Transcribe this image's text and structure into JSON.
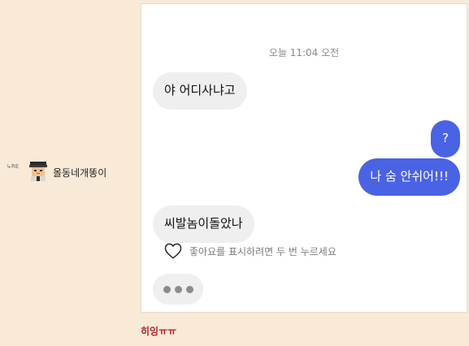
{
  "post": {
    "reply_tag": "↳RE",
    "author": "올동네개똥이",
    "caption": "히잉ㅠㅠ"
  },
  "chat": {
    "timestamp": "오늘 11:04 오전",
    "messages": [
      {
        "side": "incoming",
        "text": "야 어디사냐고"
      },
      {
        "side": "outgoing",
        "text": "?"
      },
      {
        "side": "outgoing",
        "text": "나 숨 안쉬어!!!"
      },
      {
        "side": "incoming",
        "text": "씨발놈이돌았나"
      }
    ],
    "like_hint": "좋아요를 표시하려면 두 번 누르세요",
    "typing_indicator": true
  },
  "colors": {
    "page_background": "#f9ead8",
    "outgoing_bubble": "#4a63e4",
    "incoming_bubble": "#efefef",
    "caption": "#b2212c"
  },
  "icons": [
    "avatar-pixel-icon",
    "heart-icon",
    "typing-dots-icon"
  ]
}
